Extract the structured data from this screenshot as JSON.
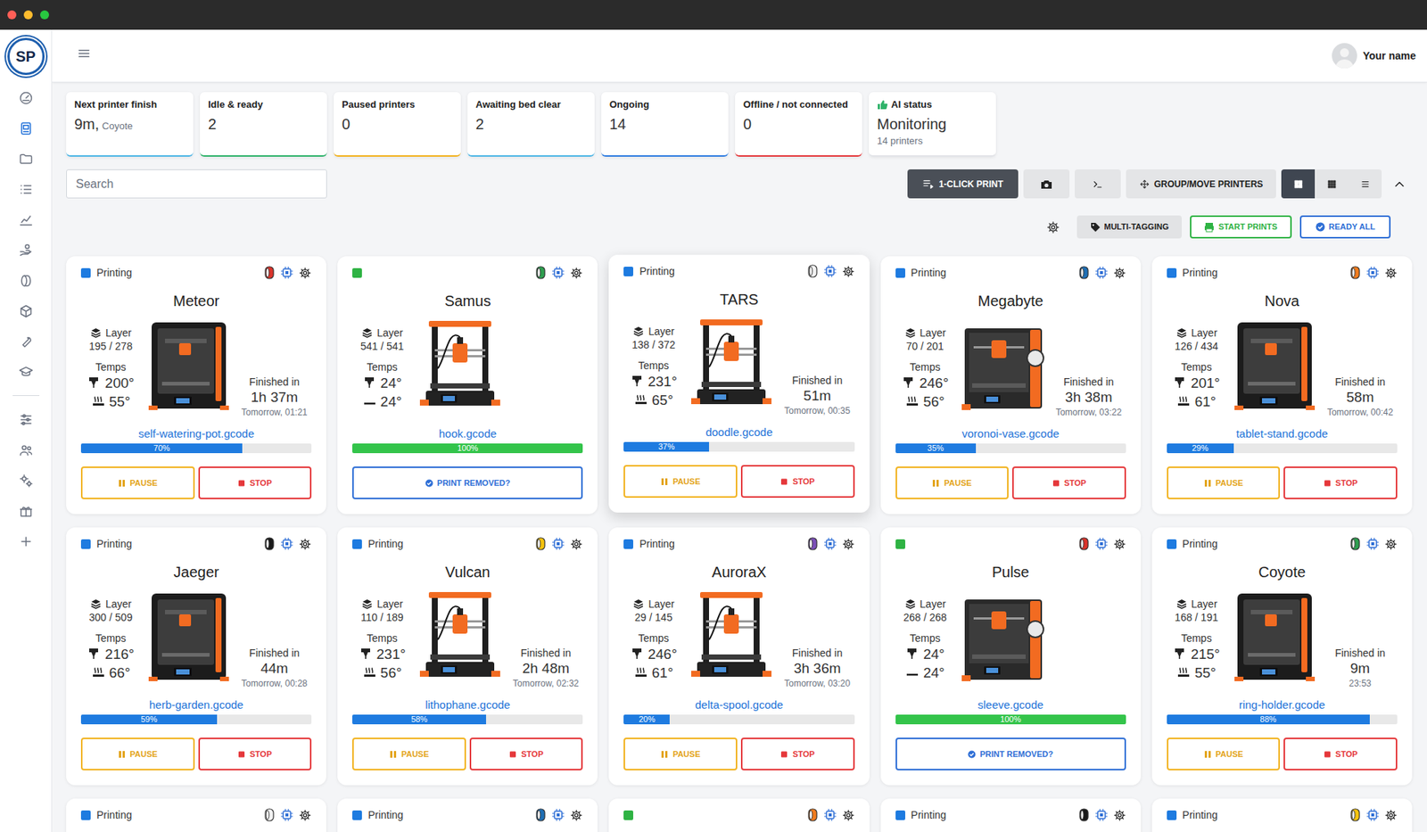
{
  "window": {
    "controls": [
      {
        "color": "#ff5f57"
      },
      {
        "color": "#febc2e"
      },
      {
        "color": "#28c840"
      }
    ]
  },
  "logo": "SP",
  "sidebar": {
    "items": [
      {
        "selected": false
      },
      {
        "selected": true
      },
      {
        "selected": false
      },
      {
        "selected": false
      },
      {
        "selected": false
      },
      {
        "selected": false
      },
      {
        "selected": false
      },
      {
        "selected": false
      },
      {
        "selected": false
      },
      {
        "selected": false
      },
      {
        "selected": false
      },
      {
        "selected": false
      },
      {
        "selected": false
      },
      {
        "selected": false
      },
      {
        "selected": false
      }
    ]
  },
  "header": {
    "user": "Your name"
  },
  "stats": [
    {
      "kind": "time",
      "label": "Next printer finish",
      "value": "9m,",
      "sub": "Coyote",
      "color": "#4db6e6"
    },
    {
      "kind": "count",
      "label": "Idle & ready",
      "value": "2",
      "color": "#2fb36a"
    },
    {
      "kind": "count",
      "label": "Paused printers",
      "value": "0",
      "color": "#f2b320"
    },
    {
      "kind": "count",
      "label": "Awaiting bed clear",
      "value": "2",
      "color": "#4db6e6"
    },
    {
      "kind": "count",
      "label": "Ongoing",
      "value": "14",
      "color": "#2f7de1"
    },
    {
      "kind": "count",
      "label": "Offline / not connected",
      "value": "0",
      "color": "#e5383b"
    },
    {
      "kind": "ai",
      "label": "AI status",
      "value": "Monitoring",
      "sub": "14 printers",
      "color": "#e2e4e8"
    }
  ],
  "search": {
    "placeholder": "Search"
  },
  "toolbar": {
    "one_click": "1-CLICK PRINT",
    "group": "GROUP/MOVE PRINTERS",
    "views": [
      {
        "selected": true
      },
      {
        "selected": false
      },
      {
        "selected": false
      }
    ],
    "multi_tagging": "MULTI-TAGGING",
    "start_prints": "START PRINTS",
    "ready_all": "READY ALL"
  },
  "printers": [
    {
      "status": "printing",
      "status_label": "Printing",
      "spool_color": "#d9342b",
      "highlighted": false,
      "name": "Meteor",
      "kind": "enclosed",
      "layer_label": "Layer",
      "layer": "195 / 278",
      "temps_label": "Temps",
      "nozzle": "200°",
      "bed": "55°",
      "bed_heating": true,
      "finish_label": "Finished in",
      "finish_in": "1h 37m",
      "finish_at": "Tomorrow, 01:21",
      "file": "self-watering-pot.gcode",
      "level": 0.7,
      "progress": "70%",
      "actions": [
        {
          "label": "PAUSE",
          "kind": "pause"
        },
        {
          "label": "STOP",
          "kind": "stop"
        }
      ]
    },
    {
      "status": "done",
      "spool_color": "#2e9e4f",
      "highlighted": false,
      "name": "Samus",
      "kind": "open",
      "layer_label": "Layer",
      "layer": "541 / 541",
      "temps_label": "Temps",
      "nozzle": "24°",
      "bed": "24°",
      "bed_heating": false,
      "file": "hook.gcode",
      "level": 1.0,
      "progress": "100%",
      "actions": [
        {
          "label": "PRINT REMOVED?",
          "kind": "removed"
        }
      ]
    },
    {
      "status": "printing",
      "status_label": "Printing",
      "spool_color": "#f2f2f2",
      "highlighted": true,
      "name": "TARS",
      "kind": "open",
      "layer_label": "Layer",
      "layer": "138 / 372",
      "temps_label": "Temps",
      "nozzle": "231°",
      "bed": "65°",
      "bed_heating": true,
      "finish_label": "Finished in",
      "finish_in": "51m",
      "finish_at": "Tomorrow, 00:35",
      "file": "doodle.gcode",
      "level": 0.37,
      "progress": "37%",
      "actions": [
        {
          "label": "PAUSE",
          "kind": "pause"
        },
        {
          "label": "STOP",
          "kind": "stop"
        }
      ]
    },
    {
      "status": "printing",
      "status_label": "Printing",
      "spool_color": "#1f6fb5",
      "highlighted": false,
      "name": "Megabyte",
      "kind": "open-spool",
      "layer_label": "Layer",
      "layer": "70 / 201",
      "temps_label": "Temps",
      "nozzle": "246°",
      "bed": "56°",
      "bed_heating": true,
      "finish_label": "Finished in",
      "finish_in": "3h 38m",
      "finish_at": "Tomorrow, 03:22",
      "file": "voronoi-vase.gcode",
      "level": 0.35,
      "progress": "35%",
      "actions": [
        {
          "label": "PAUSE",
          "kind": "pause"
        },
        {
          "label": "STOP",
          "kind": "stop"
        }
      ]
    },
    {
      "status": "printing",
      "status_label": "Printing",
      "spool_color": "#f07b1d",
      "highlighted": false,
      "name": "Nova",
      "kind": "enclosed",
      "layer_label": "Layer",
      "layer": "126 / 434",
      "temps_label": "Temps",
      "nozzle": "201°",
      "bed": "61°",
      "bed_heating": true,
      "finish_label": "Finished in",
      "finish_in": "58m",
      "finish_at": "Tomorrow, 00:42",
      "file": "tablet-stand.gcode",
      "level": 0.29,
      "progress": "29%",
      "actions": [
        {
          "label": "PAUSE",
          "kind": "pause"
        },
        {
          "label": "STOP",
          "kind": "stop"
        }
      ]
    },
    {
      "status": "printing",
      "status_label": "Printing",
      "spool_color": "#1a1a1a",
      "highlighted": false,
      "name": "Jaeger",
      "kind": "enclosed",
      "layer_label": "Layer",
      "layer": "300 / 509",
      "temps_label": "Temps",
      "nozzle": "216°",
      "bed": "66°",
      "bed_heating": true,
      "finish_label": "Finished in",
      "finish_in": "44m",
      "finish_at": "Tomorrow, 00:28",
      "file": "herb-garden.gcode",
      "level": 0.59,
      "progress": "59%",
      "actions": [
        {
          "label": "PAUSE",
          "kind": "pause"
        },
        {
          "label": "STOP",
          "kind": "stop"
        }
      ]
    },
    {
      "status": "printing",
      "status_label": "Printing",
      "spool_color": "#f4c20d",
      "highlighted": false,
      "name": "Vulcan",
      "kind": "open",
      "layer_label": "Layer",
      "layer": "110 / 189",
      "temps_label": "Temps",
      "nozzle": "231°",
      "bed": "56°",
      "bed_heating": true,
      "finish_label": "Finished in",
      "finish_in": "2h 48m",
      "finish_at": "Tomorrow, 02:32",
      "file": "lithophane.gcode",
      "level": 0.58,
      "progress": "58%",
      "actions": [
        {
          "label": "PAUSE",
          "kind": "pause"
        },
        {
          "label": "STOP",
          "kind": "stop"
        }
      ]
    },
    {
      "status": "printing",
      "status_label": "Printing",
      "spool_color": "#7b4fb8",
      "highlighted": false,
      "name": "AuroraX",
      "kind": "open",
      "layer_label": "Layer",
      "layer": "29 / 145",
      "temps_label": "Temps",
      "nozzle": "246°",
      "bed": "61°",
      "bed_heating": true,
      "finish_label": "Finished in",
      "finish_in": "3h 36m",
      "finish_at": "Tomorrow, 03:20",
      "file": "delta-spool.gcode",
      "level": 0.2,
      "progress": "20%",
      "actions": [
        {
          "label": "PAUSE",
          "kind": "pause"
        },
        {
          "label": "STOP",
          "kind": "stop"
        }
      ]
    },
    {
      "status": "done",
      "spool_color": "#d9342b",
      "highlighted": false,
      "name": "Pulse",
      "kind": "open-spool",
      "layer_label": "Layer",
      "layer": "268 / 268",
      "temps_label": "Temps",
      "nozzle": "24°",
      "bed": "24°",
      "bed_heating": false,
      "file": "sleeve.gcode",
      "level": 1.0,
      "progress": "100%",
      "actions": [
        {
          "label": "PRINT REMOVED?",
          "kind": "removed"
        }
      ]
    },
    {
      "status": "printing",
      "status_label": "Printing",
      "spool_color": "#2e9e4f",
      "highlighted": false,
      "name": "Coyote",
      "kind": "enclosed",
      "layer_label": "Layer",
      "layer": "168 / 191",
      "temps_label": "Temps",
      "nozzle": "215°",
      "bed": "55°",
      "bed_heating": true,
      "finish_label": "Finished in",
      "finish_in": "9m",
      "finish_at": "23:53",
      "file": "ring-holder.gcode",
      "level": 0.88,
      "progress": "88%",
      "actions": [
        {
          "label": "PAUSE",
          "kind": "pause"
        },
        {
          "label": "STOP",
          "kind": "stop"
        }
      ]
    },
    {
      "status": "printing",
      "status_label": "Printing",
      "spool_color": "#f2f2f2",
      "highlighted": false
    },
    {
      "status": "printing",
      "status_label": "Printing",
      "spool_color": "#1f6fb5",
      "highlighted": false
    },
    {
      "status": "done",
      "spool_color": "#f07b1d",
      "highlighted": false
    },
    {
      "status": "printing",
      "status_label": "Printing",
      "spool_color": "#1a1a1a",
      "highlighted": false
    },
    {
      "status": "printing",
      "status_label": "Printing",
      "spool_color": "#f4c20d",
      "highlighted": false
    }
  ]
}
